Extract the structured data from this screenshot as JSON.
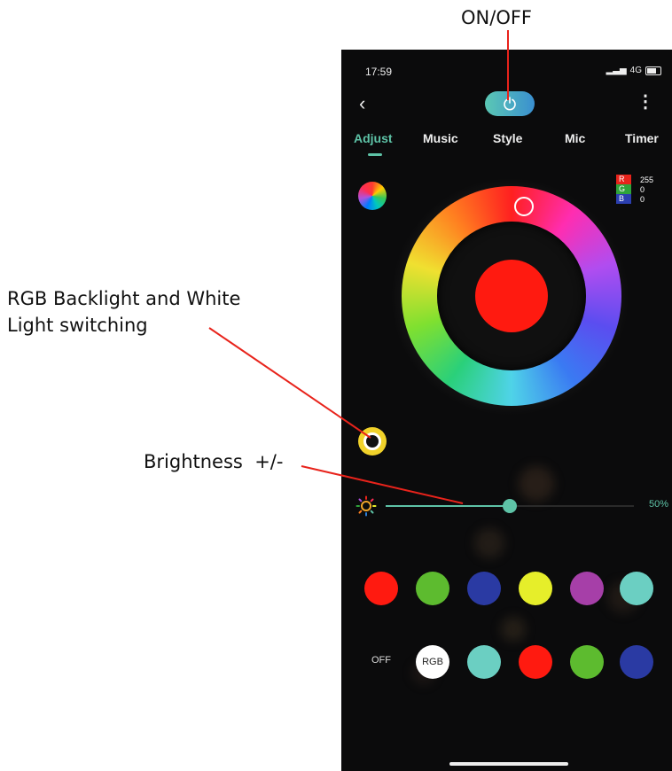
{
  "callouts": {
    "on_off": "ON/OFF",
    "rgb_switch": "RGB Backlight and White Light switching",
    "brightness": "Brightness  +/-"
  },
  "status_bar": {
    "time": "17:59",
    "network": "4G"
  },
  "header": {
    "back_icon": "chevron-left-icon",
    "power_icon": "power-icon",
    "menu_icon": "more-vertical-icon"
  },
  "tabs": [
    {
      "label": "Adjust",
      "active": true
    },
    {
      "label": "Music",
      "active": false
    },
    {
      "label": "Style",
      "active": false
    },
    {
      "label": "Mic",
      "active": false
    },
    {
      "label": "Timer",
      "active": false
    }
  ],
  "rgb_readout": [
    {
      "key": "R",
      "value": "255",
      "color": "#e8231b"
    },
    {
      "key": "G",
      "value": "0",
      "color": "#2fa43b"
    },
    {
      "key": "B",
      "value": "0",
      "color": "#2b3fb0"
    }
  ],
  "current_color": "#ff1a10",
  "brightness": {
    "value_label": "50%",
    "percent": 50,
    "accent": "#5ec3a7"
  },
  "swatches_row1": [
    "#ff1a10",
    "#5dbb2f",
    "#2a3aa3",
    "#e6ee2a",
    "#a63fa8",
    "#6bcfc2"
  ],
  "swatches_row2": {
    "off_label": "OFF",
    "rgb_label": "RGB",
    "colors": [
      "#6bcfc2",
      "#ff1a10",
      "#5dbb2f",
      "#2a3aa3"
    ]
  }
}
